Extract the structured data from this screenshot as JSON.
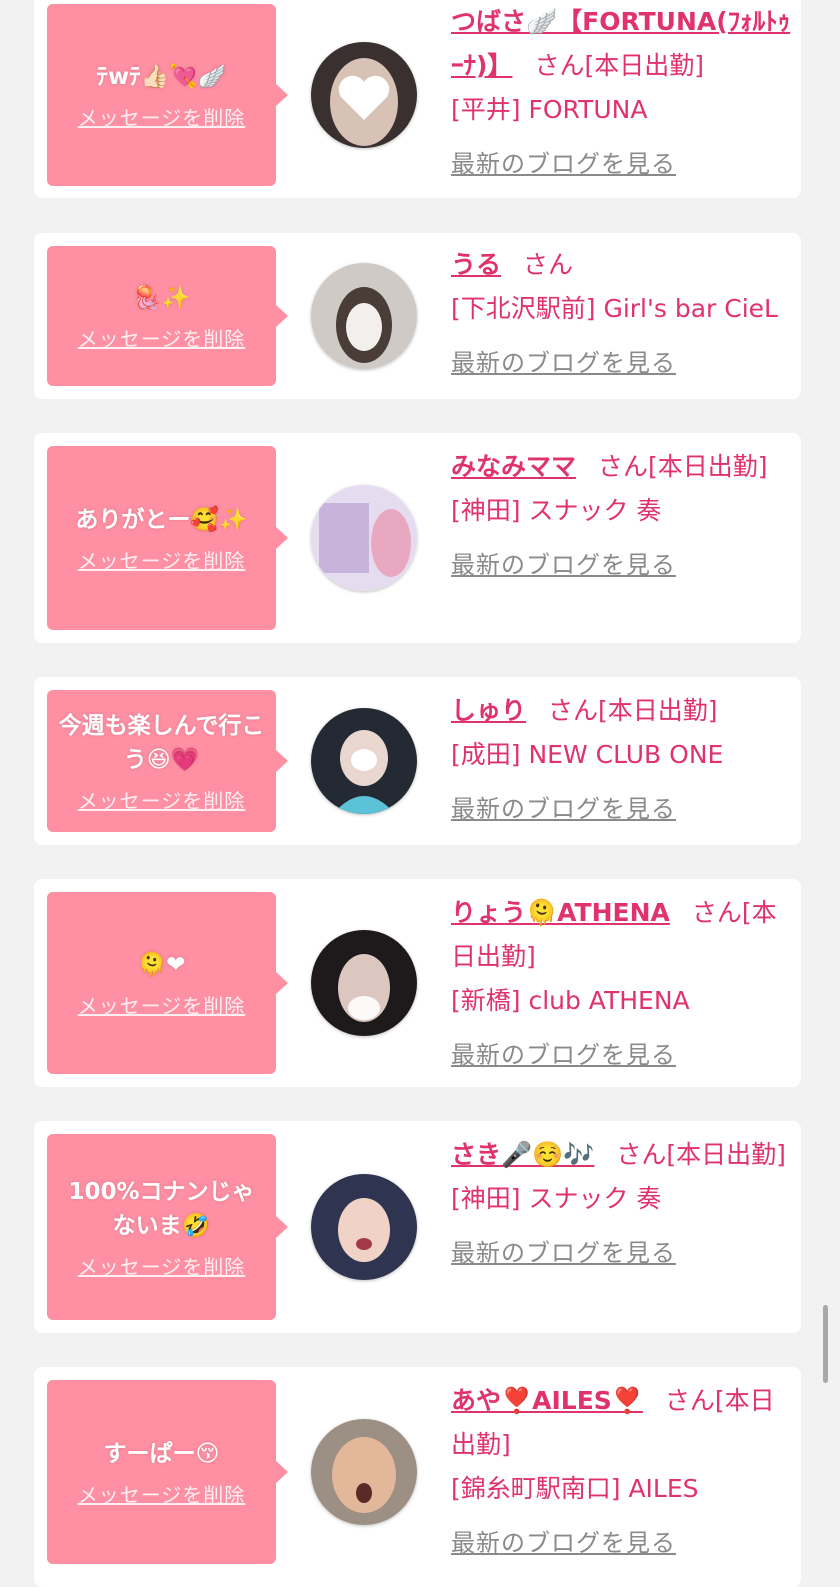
{
  "cards": [
    {
      "message": "ﾃwﾃ👍🏻💘🪽",
      "delete_label": "メッセージを削除",
      "name": "つばさ🪽【FORTUNA(ﾌｫﾙﾄｩｰﾅ)】",
      "suffix": "さん[本日出勤]",
      "shop": "[平井] FORTUNA",
      "blog_label": "最新のブログを見る"
    },
    {
      "message": "🪼✨",
      "delete_label": "メッセージを削除",
      "name": "うる",
      "suffix": "さん",
      "shop": "[下北沢駅前] Girl's bar CieL",
      "blog_label": "最新のブログを見る"
    },
    {
      "message": "ありがとー🥰✨",
      "delete_label": "メッセージを削除",
      "name": "みなみママ",
      "suffix": "さん[本日出勤]",
      "shop": "[神田] スナック 奏",
      "blog_label": "最新のブログを見る"
    },
    {
      "message": "今週も楽しんで行こう😆💗",
      "delete_label": "メッセージを削除",
      "name": "しゅり",
      "suffix": "さん[本日出勤]",
      "shop": "[成田] NEW CLUB ONE",
      "blog_label": "最新のブログを見る"
    },
    {
      "message": "🫠❤",
      "delete_label": "メッセージを削除",
      "name": "りょう🫠ATHENA",
      "suffix": "さん[本日出勤]",
      "shop": "[新橋] club ATHENA",
      "blog_label": "最新のブログを見る"
    },
    {
      "message": "100%コナンじゃないま🤣",
      "delete_label": "メッセージを削除",
      "name": "さき🎤☺️🎶",
      "suffix": "さん[本日出勤]",
      "shop": "[神田] スナック 奏",
      "blog_label": "最新のブログを見る"
    },
    {
      "message": "すーぱー😚",
      "delete_label": "メッセージを削除",
      "name": "あや❣️AILES❣️",
      "suffix": "さん[本日出勤]",
      "shop": "[錦糸町駅南口] AILES",
      "blog_label": "最新のブログを見る"
    }
  ]
}
